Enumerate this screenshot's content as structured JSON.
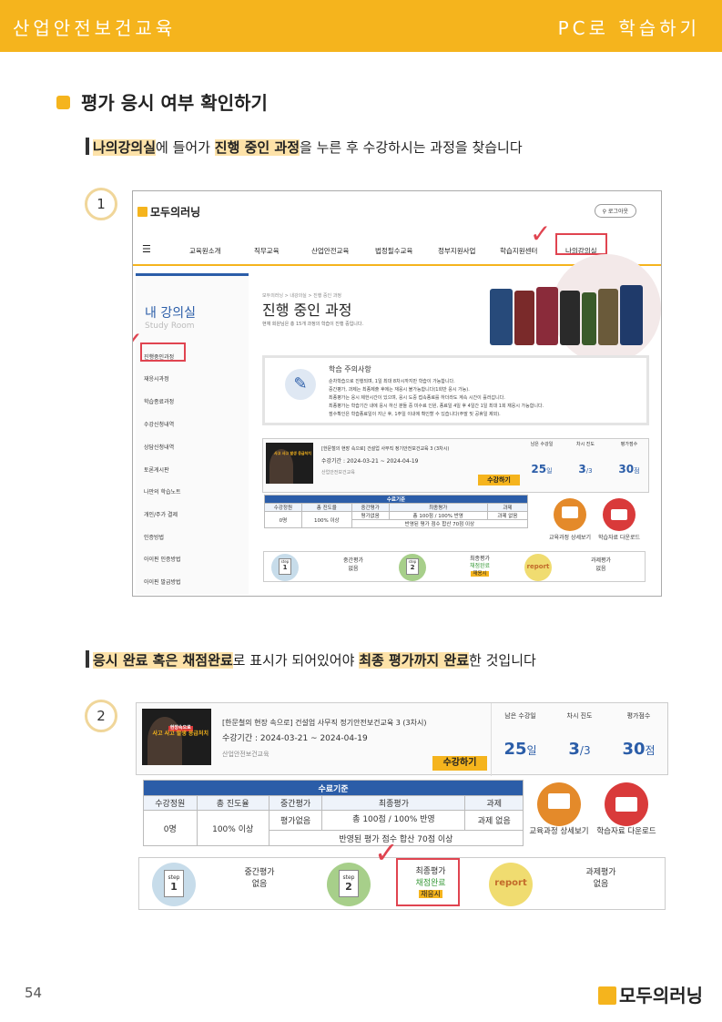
{
  "header": {
    "left": "산업안전보건교육",
    "right": "PC로 학습하기"
  },
  "section_title": "평가 응시 여부 확인하기",
  "instruction1": {
    "p1": "나의강의실",
    "p2": "에 들어가 ",
    "p3": "진행 중인 과정",
    "p4": "을 누른 후 수강하시는 과정을 찾습니다"
  },
  "step1": "1",
  "step2": "2",
  "instruction2": {
    "p1": "응시 완료 혹은 채점완료",
    "p2": "로 표시가 되어있어야 ",
    "p3": "최종 평가까지 완료",
    "p4": "한 것입니다"
  },
  "site": {
    "logo": "모두의러닝",
    "login": "로그아웃",
    "nav": [
      "교육원소개",
      "직무교육",
      "산업안전교육",
      "법정필수교육",
      "정부지원사업",
      "학습지원센터",
      "나의강의실"
    ],
    "side_title": "내 강의실",
    "side_sub": "Study Room",
    "side_items": [
      "진행중인과정",
      "재응시과정",
      "학습종료과정",
      "수강신청내역",
      "상담신청내역",
      "토론게시판",
      "나만의 학습노트",
      "개인/주가 결제",
      "인증방법",
      "아이핀 인증방법",
      "아이핀 발급방법"
    ],
    "breadcrumb": "모두의러닝 > 내강의실 > 진행 중인 과정",
    "page_title": "진행 중인 과정",
    "page_sub": "현재 회원님은 총 15개 과정의 학습이 진행 중입니다.",
    "notice_title": "학습 주의사항",
    "notice_lines": [
      "순차학습으로 진행되며, 1일 최대 8차시까지만 학습이 가능합니다.",
      "중간평가, 과제는 최종제출 후에는 재응시 불가능합니다(1회만 응시 가능).",
      "최종평가는 응시 제한시간이 있으며, 응시 도중 접속종료를 하더라도 계속 시간이 흘러갑니다.",
      "최종평가는 학습기간 내에 응시 하신 분들 중 미수료 인원, 종료일 4일 후 4일간 1일 최대 1회 재응시 가능합니다.",
      "점수확인은 학습종료일이 지난 후, 1주일 이내에 확인할 수 있습니다(주말 및 공휴일 제외)."
    ]
  },
  "course": {
    "title": "[한문철의 현장 속으로] 건설업 사무직 정기안전보건교육 3 (3차시)",
    "period": "수강기간 : 2024-03-21 ~ 2024-04-19",
    "org": "산업안전보건교육",
    "button": "수강하기",
    "thumb_badge": "현장속으로",
    "thumb_text": "사고 사고 발생 응급처치",
    "stats_labels": [
      "남은 수강일",
      "차시 진도",
      "평가점수"
    ],
    "days_num": "25",
    "days_unit": "일",
    "prog_num": "3",
    "prog_unit": "/3",
    "score_num": "30",
    "score_unit": "점",
    "req_title": "수료기준",
    "req_headers": [
      "수강정원",
      "총 진도율",
      "중간평가",
      "최종평가",
      "과제"
    ],
    "req_values": [
      "0명",
      "100% 이상",
      "평가없음",
      "총 100점 / 100% 반영",
      "과제 없음"
    ],
    "req_note": "반영된 평가 점수 합산 70점 이상",
    "btn_detail": "교육과정 상세보기",
    "btn_download": "학습자료 다운로드",
    "eval_mid_label": "중간평가",
    "eval_mid_value": "없음",
    "eval_final_label": "최종평가",
    "eval_final_value": "채점완료",
    "eval_final_badge": "재응시",
    "eval_task_label": "과제평가",
    "eval_task_value": "없음",
    "step_word": "step",
    "step1_num": "1",
    "step2_num": "2",
    "report_text": "report"
  },
  "check_mark": "✓",
  "colors": {
    "accent": "#f5b41d",
    "blue": "#2b5da8",
    "red": "#e04450"
  },
  "page_number": "54",
  "footer_logo": "모두의러닝"
}
